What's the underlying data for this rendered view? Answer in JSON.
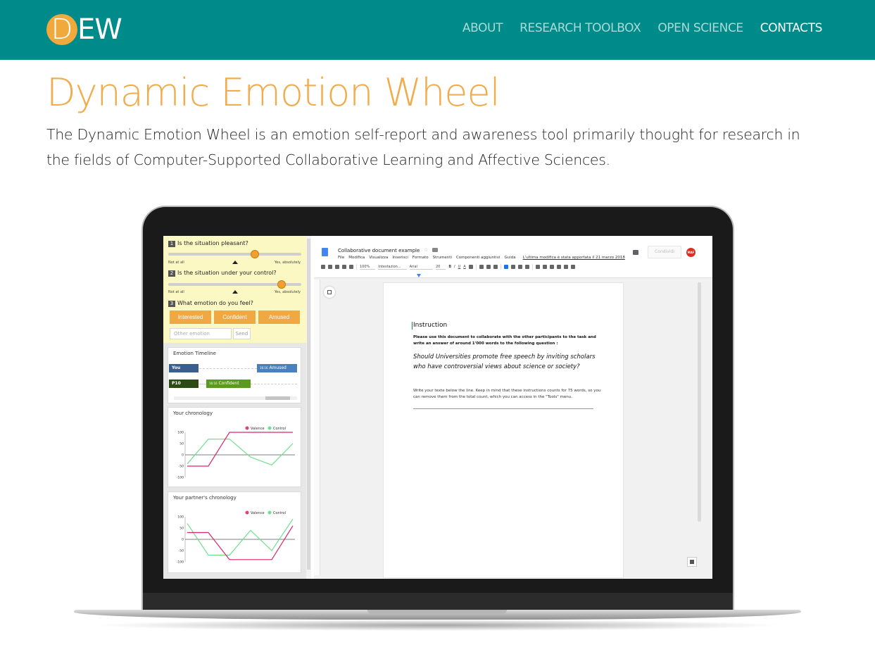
{
  "header": {
    "logo_initial": "D",
    "logo_rest": "EW",
    "nav": [
      {
        "label": "ABOUT"
      },
      {
        "label": "RESEARCH TOOLBOX"
      },
      {
        "label": "OPEN SCIENCE"
      },
      {
        "label": "CONTACTS"
      }
    ]
  },
  "main": {
    "title": "Dynamic Emotion Wheel",
    "intro": "The Dynamic Emotion Wheel is an emotion self-report and awareness tool primarily thought for research in the fields of Computer-Supported Collaborative Learning and Affective Sciences."
  },
  "screenshot": {
    "questions": [
      {
        "num": "1",
        "text": "Is the situation pleasant?",
        "min_label": "Not at all",
        "max_label": "Yes, absolutely",
        "value": 0.65
      },
      {
        "num": "2",
        "text": "Is the situation under your control?",
        "min_label": "Not at all",
        "max_label": "Yes, absolutely",
        "value": 0.85
      },
      {
        "num": "3",
        "text": "What emotion do you feel?"
      }
    ],
    "emotions": [
      "Interested",
      "Confident",
      "Amused"
    ],
    "other_emotion_placeholder": "Other emotion",
    "send_label": "Send",
    "timeline": {
      "title": "Emotion Timeline",
      "rows": [
        {
          "name": "You",
          "time": "16:16",
          "emotion": "Amused",
          "color": "#4a7fc0"
        },
        {
          "name": "P10",
          "time": "16:16",
          "emotion": "Confident",
          "color": "#5a9a1e"
        }
      ]
    },
    "your_chronology": {
      "title": "Your chronology",
      "legend": [
        "Valence",
        "Control"
      ],
      "y_ticks": [
        "100",
        "50",
        "0",
        "-50",
        "-100"
      ],
      "valence": [
        -50,
        -50,
        100,
        100,
        100,
        100
      ],
      "control": [
        -40,
        70,
        70,
        -10,
        -45,
        50
      ]
    },
    "partner_chronology": {
      "title": "Your partner's chronology",
      "legend": [
        "Valence",
        "Control"
      ],
      "y_ticks": [
        "100",
        "50",
        "0",
        "-50",
        "-100"
      ],
      "valence": [
        30,
        30,
        -90,
        -90,
        -90,
        60
      ],
      "control": [
        70,
        -70,
        -70,
        40,
        -50,
        90
      ]
    },
    "doc": {
      "title": "Collaborative document example",
      "menu": [
        "File",
        "Modifica",
        "Visualizza",
        "Inserisci",
        "Formato",
        "Strumenti",
        "Componenti aggiuntivi",
        "Guida"
      ],
      "last_edit": "L'ultima modifica è stata apportata il 21 marzo 2018",
      "share_label": "Condividi",
      "avatar": "MAF",
      "zoom": "100%",
      "style": "Intestazion...",
      "font": "Arial",
      "size": "20",
      "heading": "Instruction",
      "bold_text": "Please use this document to collaborate with the other participants to the task and write an answer of around 1'000 words to the following question :",
      "question": "Should Universities promote free speech by inviting scholars who have controversial views about science or society?",
      "note": "Write your texte below the line. Keep in mind that these instructions counts for 75 words, so you can remove them from the total count, which you can access in the \"Tools\" menu."
    }
  }
}
